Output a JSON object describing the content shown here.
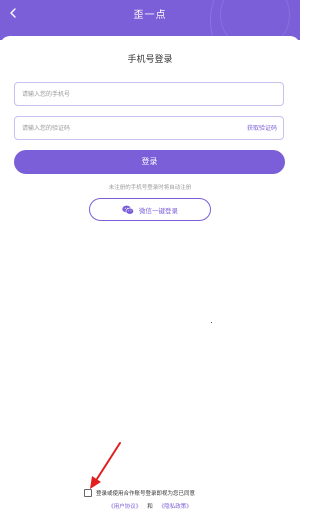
{
  "header": {
    "title": "歪一点",
    "back_icon": "chevron-left-icon",
    "background_color": "#7b5fd8"
  },
  "login": {
    "title": "手机号登录",
    "phone_placeholder": "请输入您的手机号",
    "code_placeholder": "请输入您的验证码",
    "get_code_label": "获取验证码",
    "login_button": "登录",
    "hint": "未注册的手机号登录时将自动注册",
    "wechat_button": "微信一键登录",
    "wechat_icon": "wechat-icon"
  },
  "agreement": {
    "checked": false,
    "text": "登录或使用合作账号登录即视为您已同意",
    "user_agreement": "《用户协议》",
    "and": "和",
    "privacy_policy": "《隐私政策》"
  },
  "annotation": {
    "arrow_color": "#e02020"
  },
  "colors": {
    "accent": "#7b5fd8",
    "border": "#c9c0ee",
    "muted_text": "#999999"
  }
}
